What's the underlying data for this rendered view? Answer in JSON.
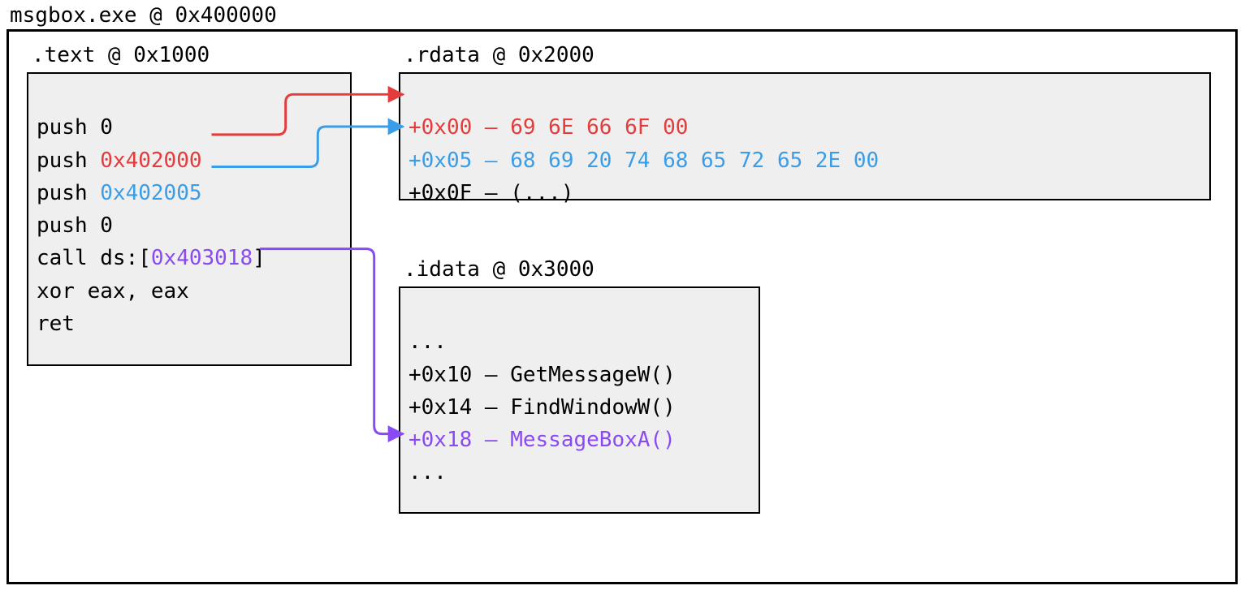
{
  "title": "msgbox.exe @ 0x400000",
  "colors": {
    "red": "#e43c3c",
    "blue": "#3a9de6",
    "purple": "#8a4af3"
  },
  "text_section": {
    "label": ".text @ 0x1000",
    "lines": {
      "push0_a": "push 0",
      "push_prefix": "push ",
      "addr_red": "0x402000",
      "addr_blue": "0x402005",
      "push0_b": "push 0",
      "call_prefix": "call ds:[",
      "call_addr": "0x403018",
      "call_suffix": "]",
      "xor": "xor eax, eax",
      "ret": "ret"
    }
  },
  "rdata_section": {
    "label": ".rdata @ 0x2000",
    "lines": {
      "r0": "+0x00 – 69 6E 66 6F 00",
      "r1": "+0x05 – 68 69 20 74 68 65 72 65 2E 00",
      "r2": "+0x0F – (...)"
    }
  },
  "idata_section": {
    "label": ".idata @ 0x3000",
    "lines": {
      "i0": "...",
      "i1": "+0x10 – GetMessageW()",
      "i2": "+0x14 – FindWindowW()",
      "i3": "+0x18 – MessageBoxA()",
      "i4": "..."
    }
  }
}
